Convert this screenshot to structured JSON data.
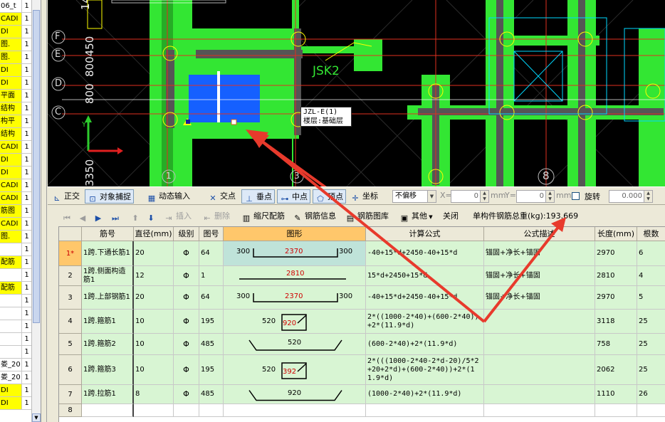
{
  "left_list": [
    {
      "name": "06_t",
      "count": "1",
      "yellow": false
    },
    {
      "name": "CADI",
      "count": "1",
      "yellow": true
    },
    {
      "name": "DI",
      "count": "1",
      "yellow": true
    },
    {
      "name": "图.",
      "count": "1",
      "yellow": true
    },
    {
      "name": "图.",
      "count": "1",
      "yellow": true
    },
    {
      "name": "DI",
      "count": "1",
      "yellow": true
    },
    {
      "name": "DI",
      "count": "1",
      "yellow": true
    },
    {
      "name": "平面",
      "count": "1",
      "yellow": true
    },
    {
      "name": "结构",
      "count": "1",
      "yellow": true
    },
    {
      "name": "构平",
      "count": "1",
      "yellow": true
    },
    {
      "name": "结构",
      "count": "1",
      "yellow": true
    },
    {
      "name": "CADI",
      "count": "1",
      "yellow": true
    },
    {
      "name": "DI",
      "count": "1",
      "yellow": true
    },
    {
      "name": "DI",
      "count": "1",
      "yellow": true
    },
    {
      "name": "CADI",
      "count": "1",
      "yellow": true
    },
    {
      "name": "CADI",
      "count": "1",
      "yellow": true
    },
    {
      "name": "筋图",
      "count": "1",
      "yellow": true
    },
    {
      "name": "CADI",
      "count": "1",
      "yellow": true
    },
    {
      "name": "图.",
      "count": "1",
      "yellow": true
    },
    {
      "name": "",
      "count": "1",
      "yellow": false
    },
    {
      "name": "配筋",
      "count": "1",
      "yellow": true
    },
    {
      "name": "",
      "count": "1",
      "yellow": false
    },
    {
      "name": "配筋",
      "count": "1",
      "yellow": true
    },
    {
      "name": "",
      "count": "1",
      "yellow": false
    },
    {
      "name": "",
      "count": "1",
      "yellow": true
    },
    {
      "name": "",
      "count": "1",
      "yellow": false
    },
    {
      "name": "",
      "count": "1",
      "yellow": true
    },
    {
      "name": "",
      "count": "1",
      "yellow": false
    },
    {
      "name": "娄_20",
      "count": "1",
      "yellow": false
    },
    {
      "name": "娄_20",
      "count": "1",
      "yellow": false
    },
    {
      "name": "DI",
      "count": "1",
      "yellow": true
    },
    {
      "name": "DI",
      "count": "1",
      "yellow": true
    }
  ],
  "cad": {
    "axis_labels": [
      "F",
      "E",
      "D",
      "C"
    ],
    "vertical_texts": [
      "1450",
      "800450",
      "800",
      "3350"
    ],
    "grid_numbers": [
      "1",
      "3",
      "8"
    ],
    "member_label": "JSK2",
    "tooltip_line1": "JZL-E(1)",
    "tooltip_line2": "楼层:基础层"
  },
  "snap_toolbar": {
    "ortho": "正交",
    "object_snap": "对象捕捉",
    "dynamic_input": "动态输入",
    "intersection": "交点",
    "perpendicular": "垂点",
    "midpoint": "中点",
    "vertex": "顶点",
    "coordinate": "坐标",
    "offset_select": "不偏移",
    "x_label": "X=",
    "x_value": "0",
    "x_unit": "mm",
    "y_label": "Y=",
    "y_value": "0",
    "y_unit": "mm",
    "rotate": "旋转",
    "rotate_value": "0.000"
  },
  "rebar_toolbar": {
    "insert": "插入",
    "delete": "删除",
    "scale_rebar": "缩尺配筋",
    "rebar_info": "钢筋信息",
    "rebar_library": "钢筋图库",
    "other": "其他",
    "close": "关闭",
    "total_weight_label": "单构件钢筋总重(kg):",
    "total_weight_value": "193.669"
  },
  "table": {
    "headers": [
      "筋号",
      "直径(mm)",
      "级别",
      "图号",
      "图形",
      "计算公式",
      "公式描述",
      "长度(mm)",
      "根数"
    ],
    "rows": [
      {
        "no": "1*",
        "name": "1跨.下通长筋1",
        "dia": "20",
        "grade": "Φ",
        "fig": "64",
        "shape": "u",
        "s_left": "300",
        "s_mid": "2370",
        "s_right": "300",
        "formula": "-40+15*d+2450-40+15*d",
        "desc": "锚固+净长+锚固",
        "length": "2970",
        "count": "6"
      },
      {
        "no": "2",
        "name": "1跨.侧面构造筋1",
        "dia": "12",
        "grade": "Φ",
        "fig": "1",
        "shape": "line",
        "s_left": "",
        "s_mid": "2810",
        "s_right": "",
        "formula": "15*d+2450+15*d",
        "desc": "锚固+净长+锚固",
        "length": "2810",
        "count": "4"
      },
      {
        "no": "3",
        "name": "1跨.上部钢筋1",
        "dia": "20",
        "grade": "Φ",
        "fig": "64",
        "shape": "u",
        "s_left": "300",
        "s_mid": "2370",
        "s_right": "300",
        "formula": "-40+15*d+2450-40+15*d",
        "desc": "锚固+净长+锚固",
        "length": "2970",
        "count": "5"
      },
      {
        "no": "4",
        "name": "1跨.箍筋1",
        "dia": "10",
        "grade": "Φ",
        "fig": "195",
        "shape": "stirrup",
        "s_left": "520",
        "s_mid": "920",
        "s_right": "",
        "formula": "2*((1000-2*40)+(600-2*40))+2*(11.9*d)",
        "desc": "",
        "length": "3118",
        "count": "25"
      },
      {
        "no": "5",
        "name": "1跨.箍筋2",
        "dia": "10",
        "grade": "Φ",
        "fig": "485",
        "shape": "tie",
        "s_left": "",
        "s_mid": "520",
        "s_right": "",
        "formula": "(600-2*40)+2*(11.9*d)",
        "desc": "",
        "length": "758",
        "count": "25"
      },
      {
        "no": "6",
        "name": "1跨.箍筋3",
        "dia": "10",
        "grade": "Φ",
        "fig": "195",
        "shape": "stirrup",
        "s_left": "520",
        "s_mid": "392",
        "s_right": "",
        "formula": "2*(((1000-2*40-2*d-20)/5*2+20+2*d)+(600-2*40))+2*(11.9*d)",
        "desc": "",
        "length": "2062",
        "count": "25"
      },
      {
        "no": "7",
        "name": "1跨.拉筋1",
        "dia": "8",
        "grade": "Φ",
        "fig": "485",
        "shape": "tie",
        "s_left": "",
        "s_mid": "920",
        "s_right": "",
        "formula": "(1000-2*40)+2*(11.9*d)",
        "desc": "",
        "length": "1110",
        "count": "26"
      },
      {
        "no": "8",
        "name": "",
        "dia": "",
        "grade": "",
        "fig": "",
        "shape": "",
        "s_left": "",
        "s_mid": "",
        "s_right": "",
        "formula": "",
        "desc": "",
        "length": "",
        "count": ""
      }
    ]
  },
  "colors": {
    "cad_bg": "#000000",
    "concrete_green": "#33e633",
    "selected_blue": "#1560ff",
    "row_green": "#d8f5d3",
    "arrow_red": "#e83a2c"
  }
}
